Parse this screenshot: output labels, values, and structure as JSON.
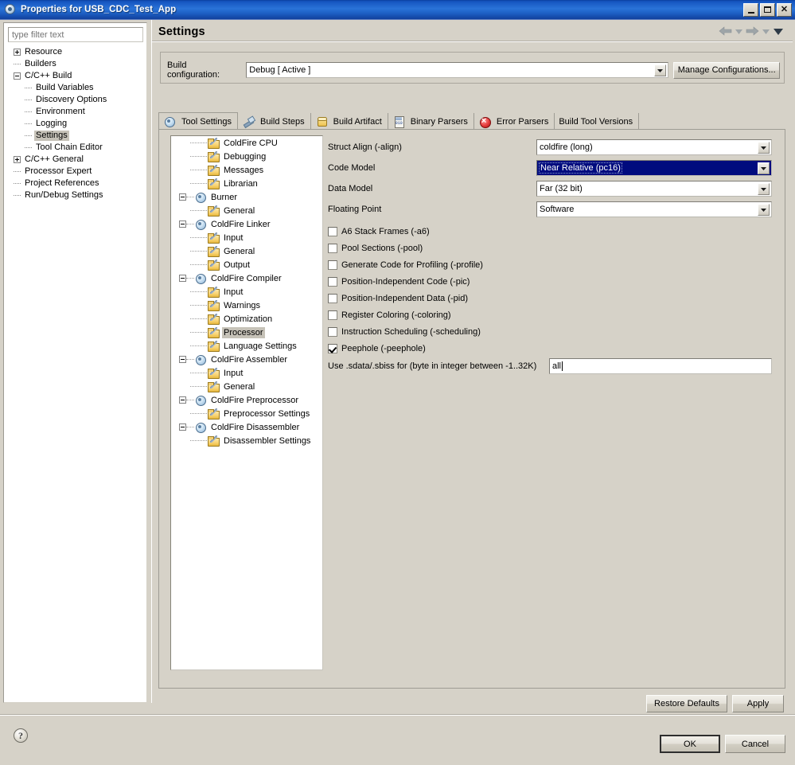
{
  "window": {
    "title": "Properties for USB_CDC_Test_App",
    "icon": "properties-app-icon",
    "minimize_label": "Minimize",
    "maximize_label": "Maximize",
    "close_label": "Close"
  },
  "filter": {
    "placeholder": "type filter text",
    "value": ""
  },
  "nav": {
    "back": "back-arrow",
    "back_menu": "back-dropdown",
    "forward": "forward-arrow",
    "forward_menu": "forward-dropdown",
    "view_menu": "view-menu"
  },
  "left_tree": [
    {
      "label": "Resource",
      "depth": 0,
      "expander": "plus",
      "selected": false
    },
    {
      "label": "Builders",
      "depth": 0,
      "expander": "none",
      "selected": false
    },
    {
      "label": "C/C++ Build",
      "depth": 0,
      "expander": "minus",
      "selected": false
    },
    {
      "label": "Build Variables",
      "depth": 1,
      "expander": "none",
      "selected": false
    },
    {
      "label": "Discovery Options",
      "depth": 1,
      "expander": "none",
      "selected": false
    },
    {
      "label": "Environment",
      "depth": 1,
      "expander": "none",
      "selected": false
    },
    {
      "label": "Logging",
      "depth": 1,
      "expander": "none",
      "selected": false
    },
    {
      "label": "Settings",
      "depth": 1,
      "expander": "none",
      "selected": true
    },
    {
      "label": "Tool Chain Editor",
      "depth": 1,
      "expander": "none",
      "selected": false
    },
    {
      "label": "C/C++ General",
      "depth": 0,
      "expander": "plus",
      "selected": false
    },
    {
      "label": "Processor Expert",
      "depth": 0,
      "expander": "none",
      "selected": false
    },
    {
      "label": "Project References",
      "depth": 0,
      "expander": "none",
      "selected": false
    },
    {
      "label": "Run/Debug Settings",
      "depth": 0,
      "expander": "none",
      "selected": false
    }
  ],
  "page": {
    "title": "Settings"
  },
  "build_configuration": {
    "label": "Build configuration:",
    "value": "Debug  [ Active ]",
    "manage_button": "Manage Configurations..."
  },
  "tabs": [
    {
      "label": "Tool Settings",
      "icon": "gear-icon",
      "active": true
    },
    {
      "label": "Build Steps",
      "icon": "hammer-icon",
      "active": false
    },
    {
      "label": "Build Artifact",
      "icon": "artifact-icon",
      "active": false
    },
    {
      "label": "Binary Parsers",
      "icon": "binary-icon",
      "active": false
    },
    {
      "label": "Error Parsers",
      "icon": "error-icon",
      "active": false
    },
    {
      "label": "Build Tool Versions",
      "icon": "none",
      "active": false
    }
  ],
  "tool_tree": [
    {
      "label": "ColdFire CPU",
      "depth": 1,
      "icon": "folder",
      "expander": "none",
      "selected": false
    },
    {
      "label": "Debugging",
      "depth": 1,
      "icon": "folder",
      "expander": "none",
      "selected": false
    },
    {
      "label": "Messages",
      "depth": 1,
      "icon": "folder",
      "expander": "none",
      "selected": false
    },
    {
      "label": "Librarian",
      "depth": 1,
      "icon": "folder",
      "expander": "none",
      "selected": false
    },
    {
      "label": "Burner",
      "depth": 0,
      "icon": "gear",
      "expander": "minus",
      "selected": false
    },
    {
      "label": "General",
      "depth": 1,
      "icon": "folder",
      "expander": "none",
      "selected": false
    },
    {
      "label": "ColdFire Linker",
      "depth": 0,
      "icon": "gear",
      "expander": "minus",
      "selected": false
    },
    {
      "label": "Input",
      "depth": 1,
      "icon": "folder",
      "expander": "none",
      "selected": false
    },
    {
      "label": "General",
      "depth": 1,
      "icon": "folder",
      "expander": "none",
      "selected": false
    },
    {
      "label": "Output",
      "depth": 1,
      "icon": "folder",
      "expander": "none",
      "selected": false
    },
    {
      "label": "ColdFire Compiler",
      "depth": 0,
      "icon": "gear",
      "expander": "minus",
      "selected": false
    },
    {
      "label": "Input",
      "depth": 1,
      "icon": "folder",
      "expander": "none",
      "selected": false
    },
    {
      "label": "Warnings",
      "depth": 1,
      "icon": "folder",
      "expander": "none",
      "selected": false
    },
    {
      "label": "Optimization",
      "depth": 1,
      "icon": "folder",
      "expander": "none",
      "selected": false
    },
    {
      "label": "Processor",
      "depth": 1,
      "icon": "folder",
      "expander": "none",
      "selected": true
    },
    {
      "label": "Language Settings",
      "depth": 1,
      "icon": "folder",
      "expander": "none",
      "selected": false
    },
    {
      "label": "ColdFire Assembler",
      "depth": 0,
      "icon": "gear",
      "expander": "minus",
      "selected": false
    },
    {
      "label": "Input",
      "depth": 1,
      "icon": "folder",
      "expander": "none",
      "selected": false
    },
    {
      "label": "General",
      "depth": 1,
      "icon": "folder",
      "expander": "none",
      "selected": false
    },
    {
      "label": "ColdFire Preprocessor",
      "depth": 0,
      "icon": "gear",
      "expander": "minus",
      "selected": false
    },
    {
      "label": "Preprocessor Settings",
      "depth": 1,
      "icon": "folder",
      "expander": "none",
      "selected": false
    },
    {
      "label": "ColdFire Disassembler",
      "depth": 0,
      "icon": "gear",
      "expander": "minus",
      "selected": false
    },
    {
      "label": "Disassembler Settings",
      "depth": 1,
      "icon": "folder",
      "expander": "none",
      "selected": false
    }
  ],
  "settings_form": {
    "combos": [
      {
        "label": "Struct Align (-align)",
        "value": "coldfire (long)",
        "selected": false
      },
      {
        "label": "Code Model",
        "value": "Near Relative (pc16)",
        "selected": true
      },
      {
        "label": "Data Model",
        "value": "Far (32 bit)",
        "selected": false
      },
      {
        "label": "Floating Point",
        "value": "Software",
        "selected": false
      }
    ],
    "checkboxes": [
      {
        "label": "A6 Stack Frames (-a6)",
        "checked": false
      },
      {
        "label": "Pool Sections (-pool)",
        "checked": false
      },
      {
        "label": "Generate Code for Profiling (-profile)",
        "checked": false
      },
      {
        "label": "Position-Independent Code (-pic)",
        "checked": false
      },
      {
        "label": "Position-Independent Data (-pid)",
        "checked": false
      },
      {
        "label": "Register Coloring (-coloring)",
        "checked": false
      },
      {
        "label": "Instruction Scheduling (-scheduling)",
        "checked": false
      },
      {
        "label": "Peephole (-peephole)",
        "checked": true
      }
    ],
    "text_field": {
      "label": "Use .sdata/.sbiss for (byte in integer between -1..32K)",
      "value": "all"
    }
  },
  "buttons": {
    "restore_defaults": "Restore Defaults",
    "apply": "Apply",
    "ok": "OK",
    "cancel": "Cancel",
    "help": "?"
  },
  "colors": {
    "title_bar_blue": "#1555c0",
    "dialog_face": "#d6d2c8",
    "selection_navy": "#000b7e",
    "tree_selection_gray": "#c6c2b8",
    "folder_yellow": "#f8d373",
    "gear_blue": "#8bb3d4",
    "error_red": "#e53b3b"
  }
}
